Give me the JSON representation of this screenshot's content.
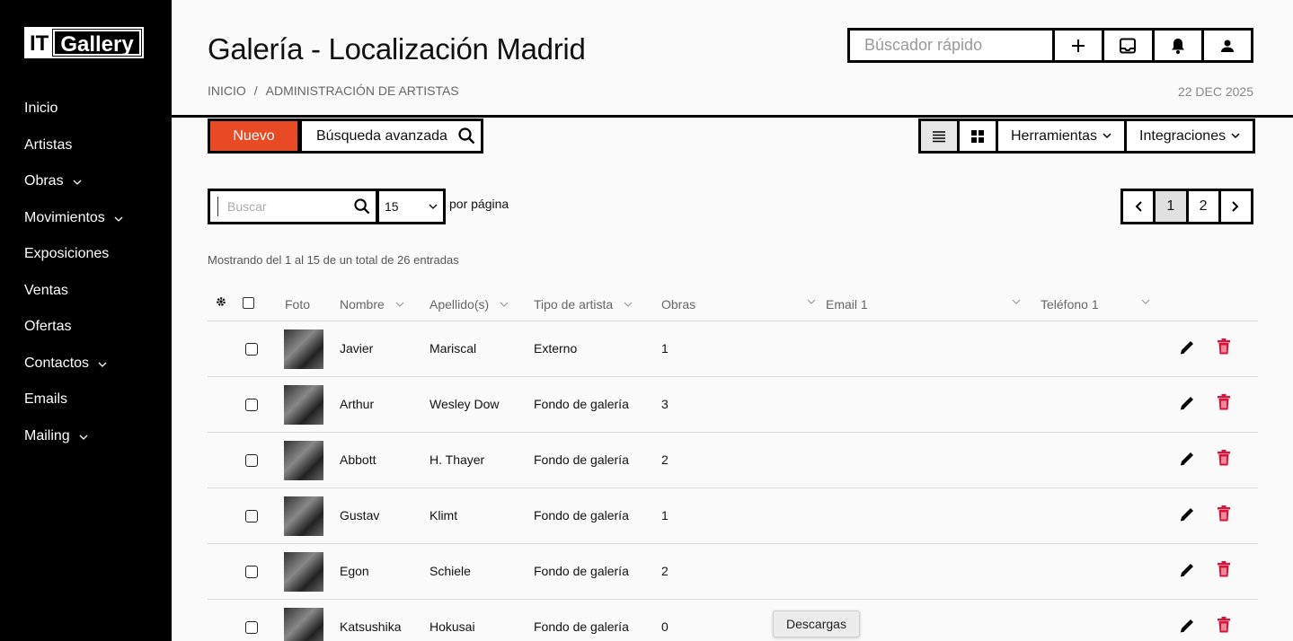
{
  "sidebar": {
    "logo_a": "IT",
    "logo_b": "Gallery",
    "items": [
      {
        "label": "Inicio",
        "chevron": false
      },
      {
        "label": "Artistas",
        "chevron": false
      },
      {
        "label": "Obras",
        "chevron": true
      },
      {
        "label": "Movimientos",
        "chevron": true
      },
      {
        "label": "Exposiciones",
        "chevron": false
      },
      {
        "label": "Ventas",
        "chevron": false
      },
      {
        "label": "Ofertas",
        "chevron": false
      },
      {
        "label": "Contactos",
        "chevron": true
      },
      {
        "label": "Emails",
        "chevron": false
      },
      {
        "label": "Mailing",
        "chevron": true
      }
    ]
  },
  "header": {
    "title": "Galería - Localización Madrid",
    "crumb_home": "INICIO",
    "crumb_sep": "/",
    "crumb_current": "ADMINISTRACIÓN DE ARTISTAS",
    "date": "22 DEC 2025",
    "quick_search_placeholder": "Búscador rápido"
  },
  "toolbar": {
    "new_label": "Nuevo",
    "advanced_label": "Búsqueda avanzada",
    "tools_label": "Herramientas",
    "integrations_label": "Integraciones"
  },
  "filters": {
    "search_placeholder": "Buscar",
    "per_page_value": "15",
    "per_page_label": "por página",
    "pages": [
      "1",
      "2"
    ],
    "current_page": "1"
  },
  "showing": "Mostrando del 1 al 15 de un total de 26 entradas",
  "table": {
    "headers": {
      "photo": "Foto",
      "name": "Nombre",
      "surname": "Apellido(s)",
      "type": "Tipo de artista",
      "works": "Obras",
      "email": "Email 1",
      "phone": "Teléfono 1"
    },
    "rows": [
      {
        "name": "Javier",
        "surname": "Mariscal",
        "type": "Externo",
        "works": "1"
      },
      {
        "name": "Arthur",
        "surname": "Wesley Dow",
        "type": "Fondo de galería",
        "works": "3"
      },
      {
        "name": "Abbott",
        "surname": "H. Thayer",
        "type": "Fondo de galería",
        "works": "2"
      },
      {
        "name": "Gustav",
        "surname": "Klimt",
        "type": "Fondo de galería",
        "works": "1"
      },
      {
        "name": "Egon",
        "surname": "Schiele",
        "type": "Fondo de galería",
        "works": "2"
      },
      {
        "name": "Katsushika",
        "surname": "Hokusai",
        "type": "Fondo de galería",
        "works": "0"
      }
    ]
  },
  "tooltip": "Descargas",
  "colors": {
    "accent": "#e84a25",
    "delete": "#d9143a"
  }
}
